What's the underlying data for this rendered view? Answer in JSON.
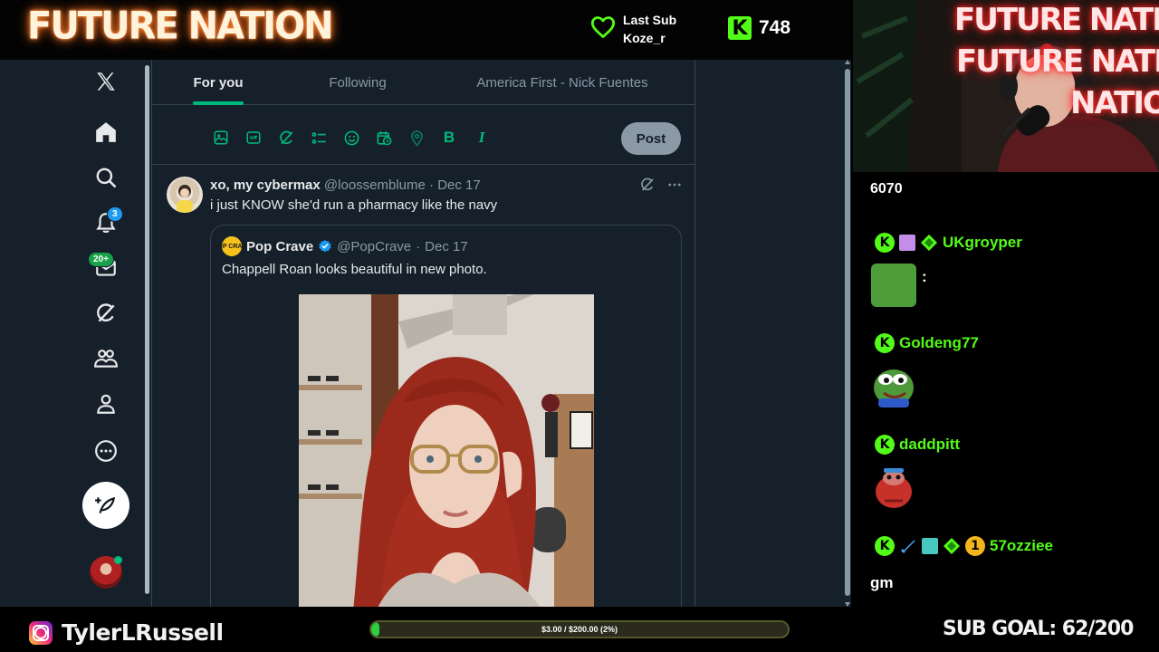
{
  "overlay": {
    "brand": "FUTURE NATION",
    "last_sub_label": "Last Sub",
    "last_sub_user": "Koze_r",
    "kick_badge": "K",
    "follower_count": "748",
    "colors": {
      "kick_green": "#53fc18",
      "brand_glow": "#ff6a1a"
    }
  },
  "x": {
    "logo": "X",
    "nav": [
      {
        "icon": "home-icon"
      },
      {
        "icon": "search-icon"
      },
      {
        "icon": "bell-icon",
        "badge": "3"
      },
      {
        "icon": "mail-icon",
        "badge": "20+"
      },
      {
        "icon": "grok-icon"
      },
      {
        "icon": "communities-icon"
      },
      {
        "icon": "profile-icon"
      },
      {
        "icon": "more-icon"
      }
    ],
    "tabs": [
      {
        "label": "For you",
        "active": true
      },
      {
        "label": "Following",
        "active": false
      },
      {
        "label": "America First - Nick Fuentes",
        "active": false
      }
    ],
    "composer": {
      "tools": [
        "image-icon",
        "gif-icon",
        "grok-icon",
        "poll-icon",
        "emoji-icon",
        "schedule-icon",
        "location-icon",
        "bold-icon",
        "italic-icon"
      ],
      "bold_glyph": "B",
      "italic_glyph": "I",
      "post_label": "Post"
    },
    "tweet": {
      "name": "xo, my cybermax",
      "handle": "@loossemblume",
      "date": "Dec 17",
      "separator": "·",
      "text": "i just KNOW she'd run a pharmacy like the navy",
      "quote": {
        "logo_text": "POP CRAVE",
        "name": "Pop Crave",
        "verified": true,
        "handle": "@PopCrave",
        "date": "Dec 17",
        "text": "Chappell Roan looks beautiful in new photo."
      }
    },
    "colors": {
      "bg": "#15202b",
      "accent": "#00ba7c",
      "text": "#e7e9ea",
      "muted": "#8b98a5"
    }
  },
  "camera": {
    "neon_lines": [
      "FUTURE NATION",
      "FUTURE NATION",
      "NATION"
    ]
  },
  "chat": {
    "viewer_count": "6070",
    "kick_badge": "K",
    "messages": [
      {
        "user": "UKgroyper",
        "badges": [
          "kick-badge",
          "gift-badge",
          "founder-diamond-badge"
        ],
        "text": ":",
        "emote": "green-blob-emote"
      },
      {
        "user": "Goldeng77",
        "badges": [
          "kick-badge"
        ],
        "text": "",
        "emote": "pepe-emote"
      },
      {
        "user": "daddpitt",
        "badges": [
          "kick-badge"
        ],
        "text": "",
        "emote": "red-creature-emote"
      },
      {
        "user": "57ozziee",
        "badges": [
          "kick-badge",
          "sword-badge",
          "gift-badge",
          "founder-diamond-badge",
          "coin-badge"
        ],
        "coin_label": "1",
        "text": "gm",
        "emote": ""
      }
    ]
  },
  "bottom": {
    "instagram_handle": "TylerLRussell",
    "progress_label": "$3.00 / $200.00 (2%)",
    "progress_fraction": 0.02,
    "sub_goal": "SUB GOAL: 62/200"
  }
}
